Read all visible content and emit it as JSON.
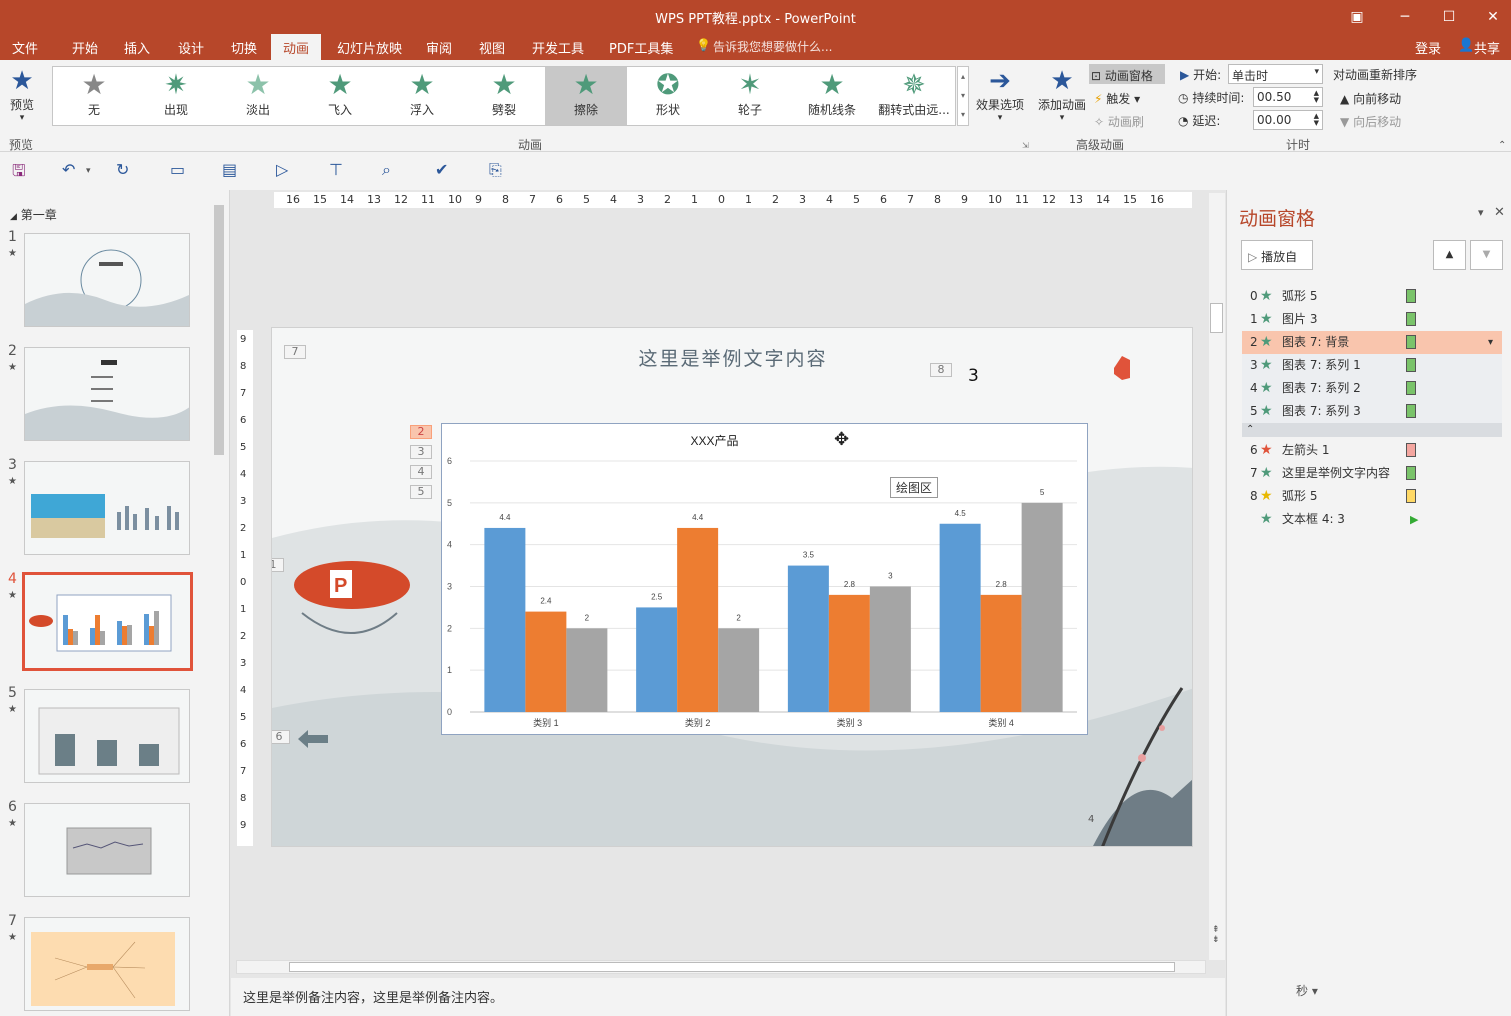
{
  "window": {
    "title": "WPS PPT教程.pptx - PowerPoint"
  },
  "menu": {
    "items": [
      "文件",
      "开始",
      "插入",
      "设计",
      "切换",
      "动画",
      "幻灯片放映",
      "审阅",
      "视图",
      "开发工具",
      "PDF工具集"
    ],
    "active": "动画",
    "search": "告诉我您想要做什么...",
    "login": "登录",
    "share": "共享"
  },
  "ribbon": {
    "preview": "预览",
    "preview_group": "预览",
    "animations": [
      "无",
      "出现",
      "淡出",
      "飞入",
      "浮入",
      "劈裂",
      "擦除",
      "形状",
      "轮子",
      "随机线条",
      "翻转式由远..."
    ],
    "selected_animation": "擦除",
    "effect_options": "效果选项",
    "anim_group": "动画",
    "add_animation": "添加动画",
    "anim_pane": "动画窗格",
    "trigger": "触发",
    "anim_painter": "动画刷",
    "adv_group": "高级动画",
    "start_label": "开始:",
    "start_value": "单击时",
    "duration_label": "持续时间:",
    "duration_value": "00.50",
    "delay_label": "延迟:",
    "delay_value": "00.00",
    "reorder": "对动画重新排序",
    "move_earlier": "向前移动",
    "move_later": "向后移动",
    "timing_group": "计时"
  },
  "thumbs": {
    "section": "第一章",
    "items": [
      "1",
      "2",
      "3",
      "4",
      "5",
      "6",
      "7"
    ],
    "selected": "4"
  },
  "slide": {
    "title": "这里是举例文字内容",
    "tag7": "7",
    "tag8": "8",
    "big_num": "3",
    "tag1": "1",
    "tag6": "6",
    "tags_chart": [
      "2",
      "3",
      "4",
      "5"
    ],
    "corner_num": "4"
  },
  "ruler": {
    "h_labels": [
      "16",
      "15",
      "14",
      "13",
      "12",
      "11",
      "10",
      "9",
      "8",
      "7",
      "6",
      "5",
      "4",
      "3",
      "2",
      "1",
      "0",
      "1",
      "2",
      "3",
      "4",
      "5",
      "6",
      "7",
      "8",
      "9",
      "10",
      "11",
      "12",
      "13",
      "14",
      "15",
      "16"
    ],
    "v_labels": [
      "9",
      "8",
      "7",
      "6",
      "5",
      "4",
      "3",
      "2",
      "1",
      "0",
      "1",
      "2",
      "3",
      "4",
      "5",
      "6",
      "7",
      "8",
      "9"
    ]
  },
  "chart_data": {
    "type": "bar",
    "title": "XXX产品",
    "categories": [
      "类别 1",
      "类别 2",
      "类别 3",
      "类别 4"
    ],
    "series": [
      {
        "values": [
          4.4,
          2.5,
          3.5,
          4.5
        ],
        "color": "#5b9bd5"
      },
      {
        "values": [
          2.4,
          4.4,
          2.8,
          2.8
        ],
        "color": "#ed7d31"
      },
      {
        "values": [
          2,
          2,
          3,
          5
        ],
        "color": "#a5a5a5"
      }
    ],
    "ylim": [
      0,
      6
    ],
    "yticks": [
      "0",
      "1",
      "2",
      "3",
      "4",
      "5",
      "6"
    ],
    "grid": true,
    "tooltip": "绘图区"
  },
  "pane": {
    "title": "动画窗格",
    "play": "播放自",
    "items": [
      {
        "n": "0",
        "name": "弧形 5",
        "color": "#7ac36a"
      },
      {
        "n": "1",
        "name": "图片 3",
        "color": "#7ac36a"
      },
      {
        "n": "2",
        "name": "图表 7: 背景",
        "color": "#7ac36a",
        "sel": true
      },
      {
        "n": "3",
        "name": "图表 7: 系列 1",
        "color": "#7ac36a"
      },
      {
        "n": "4",
        "name": "图表 7: 系列 2",
        "color": "#7ac36a"
      },
      {
        "n": "5",
        "name": "图表 7: 系列 3",
        "color": "#7ac36a"
      },
      {
        "n": "6",
        "name": "左箭头 1",
        "color": "#f4a6a0"
      },
      {
        "n": "7",
        "name": "这里是举例文字内容",
        "color": "#7ac36a"
      },
      {
        "n": "8",
        "name": "弧形 5",
        "color": "#ffd966"
      },
      {
        "n": "",
        "name": "文本框 4: 3",
        "color": ""
      }
    ],
    "seconds": "秒"
  },
  "notes": {
    "text": "这里是举例备注内容，这里是举例备注内容。"
  }
}
